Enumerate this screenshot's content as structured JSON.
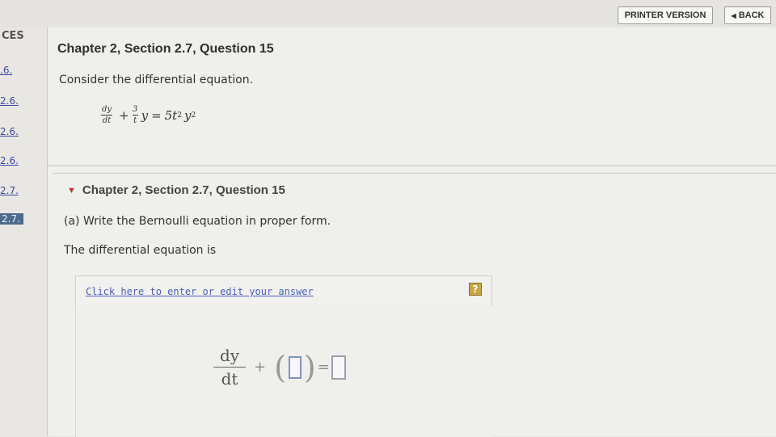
{
  "header": {
    "printer_version": "PRINTER VERSION",
    "back": "BACK"
  },
  "sidebar": {
    "heading": "CES",
    "items": [
      {
        "label": ".6."
      },
      {
        "label": "2.6."
      },
      {
        "label": "2.6."
      },
      {
        "label": "2.6."
      },
      {
        "label": "2.7."
      },
      {
        "label": "2.7."
      }
    ]
  },
  "question": {
    "title": "Chapter 2, Section 2.7, Question 15",
    "prompt": "Consider the differential equation.",
    "equation": {
      "dy": "dy",
      "dt": "dt",
      "plus": "+",
      "coef_num": "3",
      "coef_den": "t",
      "y": "y",
      "equals": "=",
      "rhs": "5t",
      "rhs_exp_t": "2",
      "rhs_y": "y",
      "rhs_exp_y": "2"
    }
  },
  "part": {
    "title": "Chapter 2, Section 2.7, Question 15",
    "part_a": "(a) Write the Bernoulli equation in proper form.",
    "intro": "The differential equation is",
    "answer_link": "Click here to enter or edit your answer",
    "help": "?",
    "answer_eq": {
      "dy": "dy",
      "dt": "dt",
      "plus": "+",
      "lparen": "(",
      "rparen": ")",
      "equals": "="
    }
  }
}
